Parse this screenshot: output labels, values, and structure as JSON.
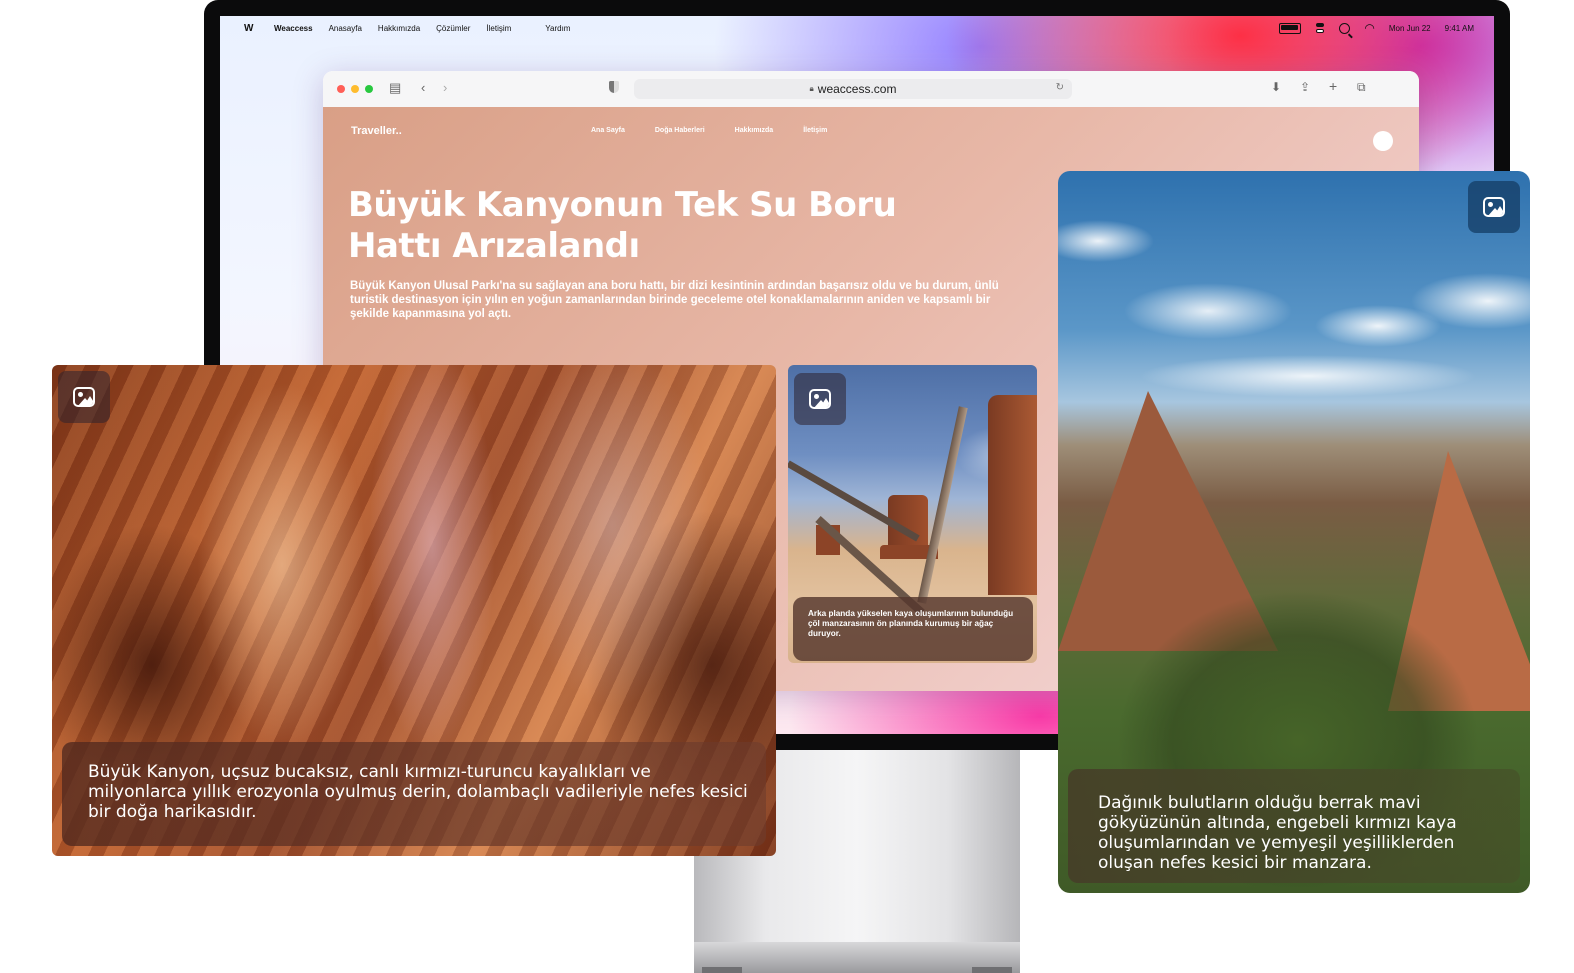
{
  "menubar": {
    "logo": "W",
    "app_name": "Weaccess",
    "items": [
      "Anasayfa",
      "Hakkımızda",
      "Çözümler",
      "İletişim",
      "Yardım"
    ],
    "date": "Mon Jun 22",
    "time": "9:41 AM"
  },
  "browser": {
    "url": "weaccess.com"
  },
  "site": {
    "brand": "Traveller..",
    "nav": [
      "Ana Sayfa",
      "Doğa Haberleri",
      "Hakkımızda",
      "İletişim"
    ],
    "headline": "Büyük Kanyonun Tek Su Boru Hattı Arızalandı",
    "lede": "Büyük Kanyon Ulusal Parkı'na su sağlayan ana boru hattı, bir dizi kesintinin ardından başarısız oldu ve bu durum, ünlü turistik destinasyon için yılın en yoğun zamanlarından birinde geceleme otel konaklamalarının aniden ve kapsamlı bir şekilde kapanmasına yol açtı."
  },
  "cards": {
    "canyon": {
      "caption": "Büyük Kanyon, uçsuz bucaksız, canlı kırmızı-turuncu kayalıkları ve milyonlarca yıllık erozyonla oyulmuş derin, dolambaçlı vadileriyle nefes kesici bir doğa harikasıdır."
    },
    "desert": {
      "caption": "Arka planda yükselen kaya oluşumlarının bulunduğu çöl manzarasının ön planında kurumuş bir ağaç duruyor."
    },
    "mountains": {
      "caption": "Dağınık bulutların olduğu berrak mavi gökyüzünün altında, engebeli kırmızı kaya oluşumlarından ve yemyeşil yeşilliklerden oluşan nefes kesici bir manzara."
    }
  },
  "colors": {
    "traffic_red": "#ff5f57",
    "traffic_yellow": "#febc2e",
    "traffic_green": "#28c840"
  }
}
